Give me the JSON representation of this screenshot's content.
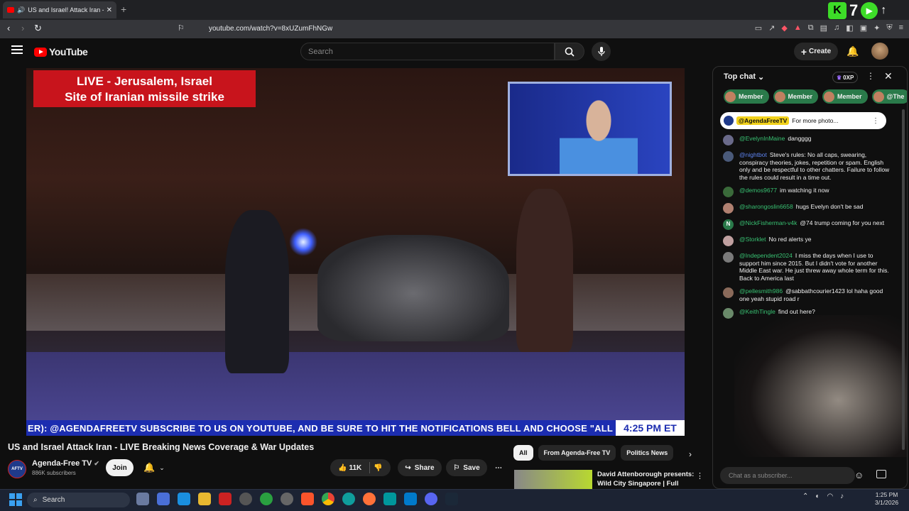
{
  "browser": {
    "tab_title": "US and Israel! Attack Iran - LIVE",
    "url": "youtube.com/watch?v=8xUZumFhNGw",
    "overlay_count": "7"
  },
  "youtube": {
    "logo_text": "YouTube",
    "search_placeholder": "Search",
    "create_label": "Create"
  },
  "video": {
    "banner_line1": "LIVE - Jerusalem, Israel",
    "banner_line2": "Site of Iranian missile strike",
    "ticker_text": "ER): @AGENDAFREETV    SUBSCRIBE TO US ON YOUTUBE, AND BE SURE TO HIT THE NOTIFICATIONS BELL AND CHOOSE \"ALL NOT",
    "ticker_time": "4:25 PM ET",
    "title": "US and Israel Attack Iran - LIVE Breaking News Coverage & War Updates",
    "channel_name": "Agenda-Free TV",
    "subscribers": "886K subscribers",
    "join_label": "Join",
    "likes": "11K",
    "share_label": "Share",
    "save_label": "Save"
  },
  "chips": [
    "All",
    "From Agenda-Free TV",
    "Politics News"
  ],
  "recommendation": {
    "title": "David Attenborough presents: Wild City Singapore | Full Serie..."
  },
  "chat": {
    "header": "Top chat",
    "xp_label": "0XP",
    "badges": [
      "Member",
      "Member",
      "Member",
      "@The"
    ],
    "pinned_author": "@AgendaFreeTV",
    "pinned_text": "For more photo...",
    "messages": [
      {
        "author": "@EvelynInMaine",
        "text": "dangggg",
        "avatar": ""
      },
      {
        "author": "@nightbot",
        "text": "Steve's rules: No all caps, swearing, conspiracy theories, jokes, repetition or spam. English only and be respectful to other chatters. Failure to follow the rules could result in a time out.",
        "avatar": ""
      },
      {
        "author": "@demos9677",
        "text": "im watching it now",
        "avatar": ""
      },
      {
        "author": "@sharongoslin6658",
        "text": "hugs Evelyn don't be sad",
        "avatar": ""
      },
      {
        "author": "@NickFisherman-v4k",
        "text": "@74 trump coming for you next",
        "avatar": "N"
      },
      {
        "author": "@Storklet",
        "text": "No red alerts ye",
        "avatar": ""
      },
      {
        "author": "@Independent2024",
        "text": "I miss the days when I use to support him since 2015. But I didn't vote for another Middle East war. He just threw away whole term for this. Back to America last",
        "avatar": ""
      },
      {
        "author": "@pellesmith986",
        "text": "@sabbathcourier1423 lol haha good one yeah stupid road r",
        "avatar": ""
      },
      {
        "author": "@KeithTingle",
        "text": "find out here?",
        "avatar": ""
      }
    ],
    "input_placeholder": "Chat as a subscriber..."
  },
  "taskbar": {
    "search_label": "Search",
    "time": "1:25 PM",
    "date": "3/1/2026"
  },
  "colors": {
    "youtube_red": "#ff0000",
    "banner_red": "#c8141c",
    "ticker_blue": "#1c2db0",
    "chat_author_green": "#38c172"
  }
}
